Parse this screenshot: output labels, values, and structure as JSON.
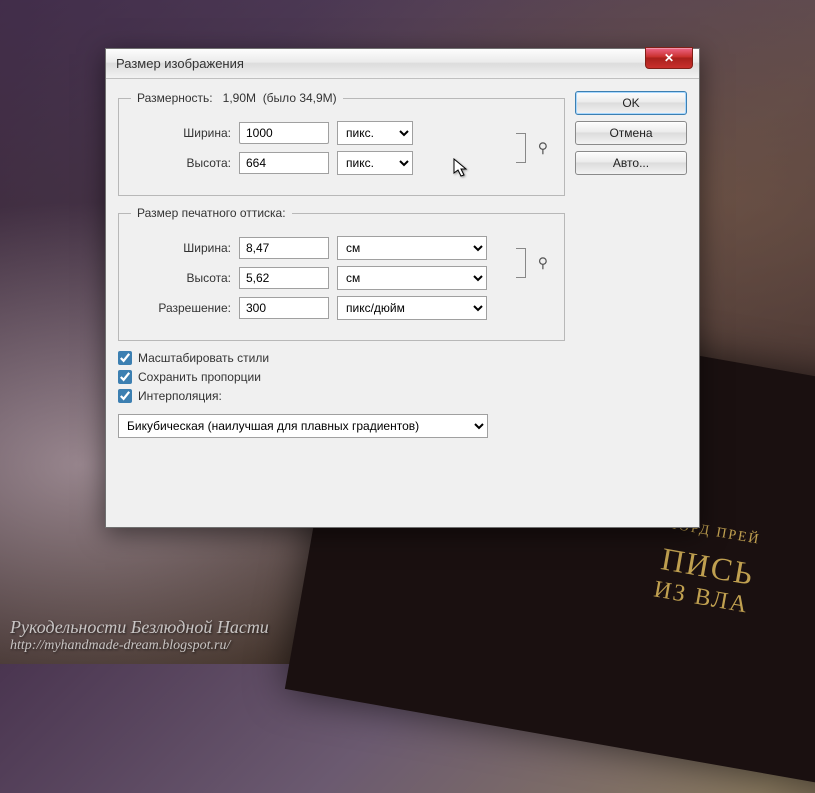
{
  "dialog": {
    "title": "Размер изображения",
    "pixel_dimensions": {
      "legend_prefix": "Размерность:",
      "size_current": "1,90M",
      "size_prev": "(было 34,9M)",
      "width_label": "Ширина:",
      "width_value": "1000",
      "height_label": "Высота:",
      "height_value": "664",
      "unit_label": "пикс."
    },
    "document_size": {
      "legend": "Размер печатного оттиска:",
      "width_label": "Ширина:",
      "width_value": "8,47",
      "height_label": "Высота:",
      "height_value": "5,62",
      "unit_label": "см",
      "resolution_label": "Разрешение:",
      "resolution_value": "300",
      "resolution_unit": "пикс/дюйм"
    },
    "checks": {
      "scale_styles": "Масштабировать стили",
      "constrain": "Сохранить пропорции",
      "interpolation": "Интерполяция:"
    },
    "interpolation_method": "Бикубическая (наилучшая для плавных градиентов)",
    "buttons": {
      "ok": "OK",
      "cancel": "Отмена",
      "auto": "Авто..."
    }
  },
  "background": {
    "book_author": "ЭЛЕОНОРА ЛОРД ПРЕЙ",
    "book_title1": "ПИСЬ",
    "book_title2": "ИЗ ВЛА",
    "watermark_line1": "Рукодельности Безлюдной Насти",
    "watermark_url": "http://myhandmade-dream.blogspot.ru/"
  }
}
